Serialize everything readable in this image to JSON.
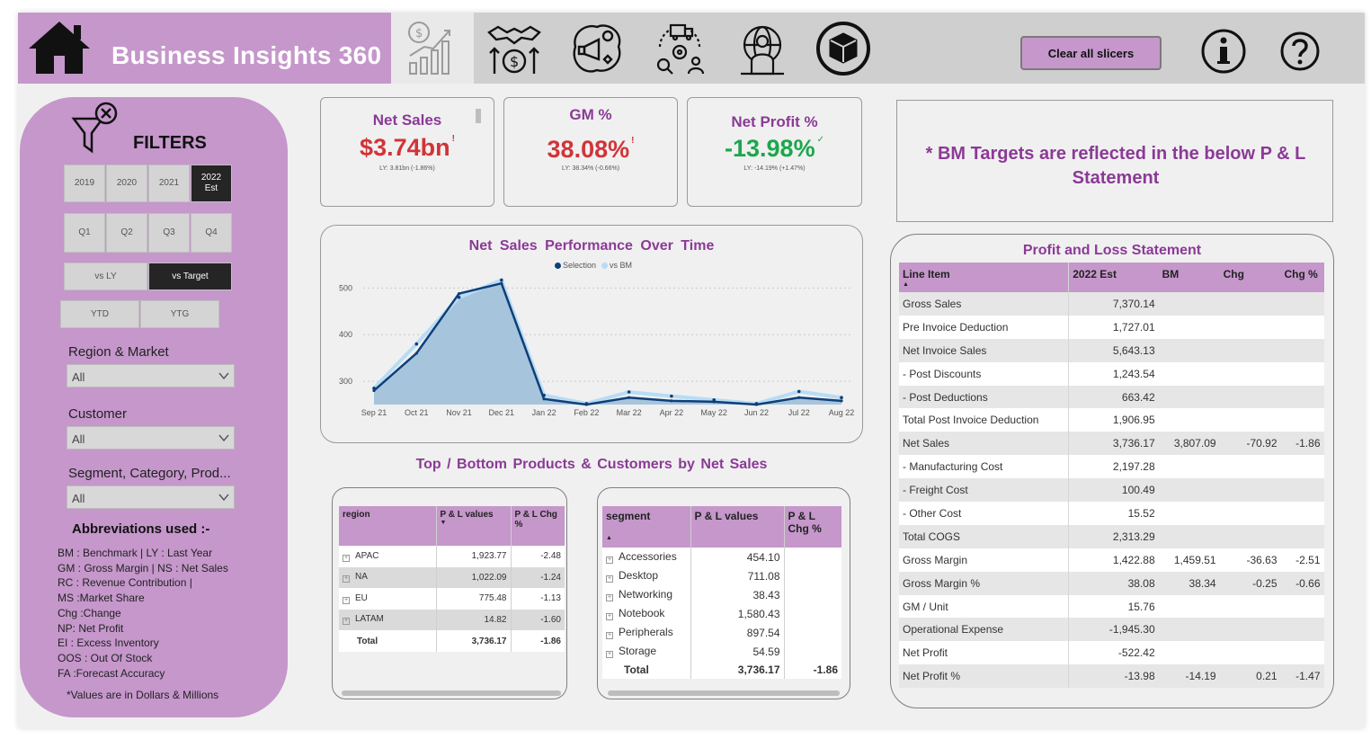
{
  "header": {
    "title": "Business Insights 360",
    "clear_label": "Clear all slicers",
    "nav_icons": [
      "finance-view-icon",
      "sales-view-icon",
      "marketing-view-icon",
      "supply-chain-view-icon",
      "executive-view-icon",
      "support-view-icon"
    ]
  },
  "filters": {
    "title": "FILTERS",
    "years": [
      {
        "label": "2019",
        "selected": false
      },
      {
        "label": "2020",
        "selected": false
      },
      {
        "label": "2021",
        "selected": false
      },
      {
        "label": "2022\nEst",
        "selected": true
      }
    ],
    "quarters": [
      {
        "label": "Q1",
        "selected": false
      },
      {
        "label": "Q2",
        "selected": false
      },
      {
        "label": "Q3",
        "selected": false
      },
      {
        "label": "Q4",
        "selected": false
      }
    ],
    "compare": [
      {
        "label": "vs LY",
        "selected": false
      },
      {
        "label": "vs Target",
        "selected": true
      }
    ],
    "period": [
      {
        "label": "YTD",
        "selected": false
      },
      {
        "label": "YTG",
        "selected": false
      }
    ],
    "region_label": "Region & Market",
    "region_value": "All",
    "customer_label": "Customer",
    "customer_value": "All",
    "segment_label": "Segment, Category, Prod...",
    "segment_value": "All",
    "abbr_title": "Abbreviations  used :-",
    "abbreviations": [
      "BM : Benchmark | LY : Last Year",
      "GM : Gross Margin  | NS : Net Sales",
      "RC  : Revenue Contribution |",
      "MS :Market Share",
      "Chg :Change",
      "NP: Net Profit",
      "EI : Excess Inventory",
      "OOS : Out Of Stock",
      "FA :Forecast Accuracy"
    ],
    "note": "*Values are in Dollars & Millions"
  },
  "kpis": {
    "net_sales": {
      "title": "Net Sales",
      "value": "$3.74bn",
      "sub": "LY: 3.81bn (-1.86%)",
      "color": "#d13438",
      "mark": "!"
    },
    "gm": {
      "title": "GM %",
      "value": "38.08%",
      "sub": "LY: 38.34% (-0.66%)",
      "color": "#d13438",
      "mark": "!"
    },
    "net_profit": {
      "title": "Net Profit %",
      "value": "-13.98%",
      "sub": "LY: -14.19% (+1.47%)",
      "color": "#1aa74b",
      "mark": "✓"
    }
  },
  "target_note": "* BM Targets are reflected in the below P & L Statement",
  "chart_data": {
    "type": "area",
    "title": "Net  Sales  Performance  Over Time",
    "categories": [
      "Sep 21",
      "Oct 21",
      "Nov 21",
      "Dec 21",
      "Jan 22",
      "Feb 22",
      "Mar 22",
      "Apr 22",
      "May 22",
      "Jun 22",
      "Jul 22",
      "Aug 22"
    ],
    "x_ticks": [
      "Sep 21",
      "Oct 21",
      "Nov 21",
      "Dec 21",
      "Jan 22",
      "Feb 22",
      "Mar 22",
      "Apr 22",
      "May 22",
      "Jun 22",
      "Jul 22",
      "Aug 22"
    ],
    "y_ticks": [
      300,
      400,
      500
    ],
    "ylim": [
      250,
      520
    ],
    "series": [
      {
        "name": "Selection",
        "color": "#0f3f78",
        "values": [
          280,
          360,
          488,
          510,
          262,
          250,
          265,
          258,
          256,
          250,
          265,
          258
        ]
      },
      {
        "name": "vs BM",
        "color": "#b8dcf5",
        "values": [
          285,
          380,
          480,
          517,
          270,
          252,
          277,
          268,
          260,
          252,
          278,
          265
        ]
      }
    ],
    "grid": true,
    "legend": "top-center"
  },
  "section_title": "Top / Bottom  Products & Customers by Net Sales",
  "region_table": {
    "headers": [
      "region",
      "P & L values",
      "P & L Chg %"
    ],
    "rows": [
      {
        "name": "APAC",
        "value": "1,923.77",
        "chg": "-2.48"
      },
      {
        "name": "NA",
        "value": "1,022.09",
        "chg": "-1.24"
      },
      {
        "name": "EU",
        "value": "775.48",
        "chg": "-1.13"
      },
      {
        "name": "LATAM",
        "value": "14.82",
        "chg": "-1.60"
      }
    ],
    "total": {
      "name": "Total",
      "value": "3,736.17",
      "chg": "-1.86"
    }
  },
  "segment_table": {
    "headers": [
      "segment",
      "P & L values",
      "P & L Chg %"
    ],
    "rows": [
      {
        "name": "Accessories",
        "value": "454.10",
        "chg": ""
      },
      {
        "name": "Desktop",
        "value": "711.08",
        "chg": ""
      },
      {
        "name": "Networking",
        "value": "38.43",
        "chg": ""
      },
      {
        "name": "Notebook",
        "value": "1,580.43",
        "chg": ""
      },
      {
        "name": "Peripherals",
        "value": "897.54",
        "chg": ""
      },
      {
        "name": "Storage",
        "value": "54.59",
        "chg": ""
      }
    ],
    "total": {
      "name": "Total",
      "value": "3,736.17",
      "chg": "-1.86"
    }
  },
  "pl": {
    "title": "Profit and Loss Statement",
    "headers": [
      "Line Item",
      "2022 Est",
      "BM",
      "Chg",
      "Chg %"
    ],
    "rows": [
      {
        "item": "Gross Sales",
        "est": "7,370.14",
        "bm": "",
        "chg": "",
        "pct": ""
      },
      {
        "item": "Pre Invoice Deduction",
        "est": "1,727.01",
        "bm": "",
        "chg": "",
        "pct": ""
      },
      {
        "item": "Net Invoice Sales",
        "est": "5,643.13",
        "bm": "",
        "chg": "",
        "pct": ""
      },
      {
        "item": " - Post Discounts",
        "est": "1,243.54",
        "bm": "",
        "chg": "",
        "pct": ""
      },
      {
        "item": " - Post Deductions",
        "est": "663.42",
        "bm": "",
        "chg": "",
        "pct": ""
      },
      {
        "item": "Total Post Invoice Deduction",
        "est": "1,906.95",
        "bm": "",
        "chg": "",
        "pct": ""
      },
      {
        "item": "Net Sales",
        "est": "3,736.17",
        "bm": "3,807.09",
        "chg": "-70.92",
        "pct": "-1.86"
      },
      {
        "item": " - Manufacturing Cost",
        "est": "2,197.28",
        "bm": "",
        "chg": "",
        "pct": ""
      },
      {
        "item": " - Freight Cost",
        "est": "100.49",
        "bm": "",
        "chg": "",
        "pct": ""
      },
      {
        "item": " - Other Cost",
        "est": "15.52",
        "bm": "",
        "chg": "",
        "pct": ""
      },
      {
        "item": "Total COGS",
        "est": "2,313.29",
        "bm": "",
        "chg": "",
        "pct": ""
      },
      {
        "item": "Gross Margin",
        "est": "1,422.88",
        "bm": "1,459.51",
        "chg": "-36.63",
        "pct": "-2.51"
      },
      {
        "item": "Gross Margin %",
        "est": "38.08",
        "bm": "38.34",
        "chg": "-0.25",
        "pct": "-0.66"
      },
      {
        "item": "GM / Unit",
        "est": "15.76",
        "bm": "",
        "chg": "",
        "pct": ""
      },
      {
        "item": "Operational Expense",
        "est": "-1,945.30",
        "bm": "",
        "chg": "",
        "pct": ""
      },
      {
        "item": "Net Profit",
        "est": "-522.42",
        "bm": "",
        "chg": "",
        "pct": ""
      },
      {
        "item": "Net Profit %",
        "est": "-13.98",
        "bm": "-14.19",
        "chg": "0.21",
        "pct": "-1.47"
      }
    ]
  },
  "colors": {
    "accent": "#c597cb",
    "title": "#8b3a96",
    "negative": "#d13438",
    "positive": "#1aa74b"
  }
}
